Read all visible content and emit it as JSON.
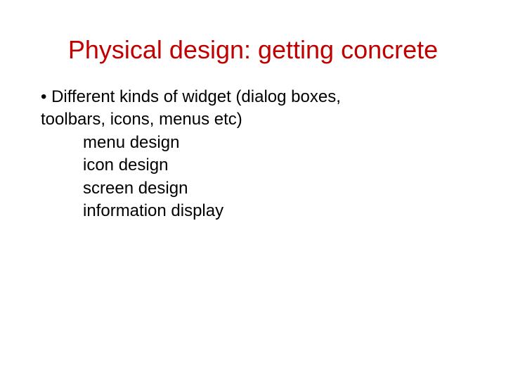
{
  "slide": {
    "title": "Physical design: getting concrete",
    "bullet_line1": "• Different kinds of widget (dialog boxes,",
    "bullet_line2": "toolbars, icons, menus etc)",
    "sub_items": [
      "menu design",
      "icon design",
      "screen design",
      "information display"
    ]
  }
}
